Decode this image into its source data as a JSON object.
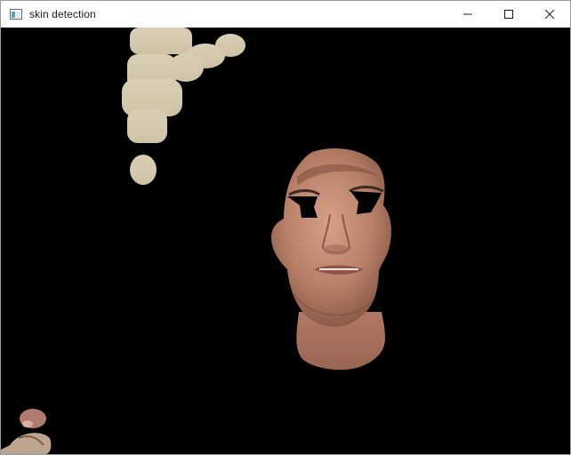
{
  "window": {
    "title": "skin detection",
    "icon": "window-app-icon"
  },
  "titlebar": {
    "controls": [
      {
        "name": "minimize-button",
        "icon": "minimize-icon"
      },
      {
        "name": "maximize-button",
        "icon": "maximize-icon"
      },
      {
        "name": "close-button",
        "icon": "close-icon"
      }
    ]
  },
  "content": {
    "description_colors": {
      "background": "#000000",
      "beige_blobs": "#d6cbb2",
      "skin": "#c08a74",
      "skin_shadow": "#8a5b48"
    }
  }
}
